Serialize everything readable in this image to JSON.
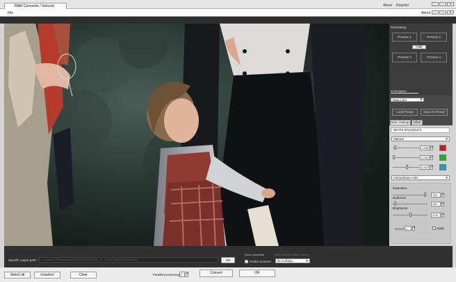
{
  "window": {
    "tab_title": "RAW Converter / Selector",
    "about_link": "About",
    "register_link": "Register",
    "win_buttons": [
      "_",
      "▫",
      "✕"
    ]
  },
  "menubar": {
    "file": "File",
    "about": "About",
    "win_buttons": [
      "_",
      "▫",
      "✕"
    ]
  },
  "previewing": {
    "title": "Previewing",
    "preview1": "Preview 1",
    "preview2": "Preview 2",
    "preview3": "Preview 3",
    "preview4": "Preview 4",
    "hide": "Hide"
  },
  "colorspace": {
    "title": "Colorspace",
    "value": "Raw color"
  },
  "presets": {
    "load": "Load Preset",
    "save": "Save As Preset"
  },
  "tabs": {
    "main_settings": "Main Settings",
    "other": "Other"
  },
  "white_balance": {
    "title": "WHITE BALANCE'S",
    "mode": "Manual",
    "rows": [
      {
        "value": "1.055",
        "level": 0.05,
        "color": "#d01818"
      },
      {
        "value": "1.000",
        "level": 0.0,
        "color": "#20b020"
      },
      {
        "value": "0.422",
        "level": 0.55,
        "color": "#20a0b0"
      }
    ]
  },
  "interpolation": {
    "value": "Interpolation AHD"
  },
  "adjust": {
    "saturation_label": "Saturation",
    "saturation_value": "750",
    "saturation_level": 0.95,
    "darkness_label": "Darkness",
    "darkness_value": "250",
    "darkness_level": 0.05,
    "brightness_label": "Brightness",
    "brightness_value": "3.00",
    "brightness_level": 0.5,
    "waves_label": "Waves",
    "waves_value": "1",
    "apply_label": "Apply",
    "apply_checked": true
  },
  "output": {
    "label": "Specific output path :",
    "path": "C:\\Users\\TC\\Pictures\\CANON\\2019\\5DIII\\0011_TL_F1789_RAW\\CUFB8838.tif",
    "set_button": "Set",
    "once_converted_label": "Once converted",
    "delete_sources": "Delete Sources",
    "when_finished_label": "When finished (batch mode)",
    "when_finished_value": "Do nothing"
  },
  "bottom": {
    "select_all": "Select all",
    "unselect": "Unselect",
    "clear": "Clear",
    "parallel_label": "Parallel processing :",
    "parallel_value": "1",
    "convert": "Convert",
    "ok": "OK"
  }
}
